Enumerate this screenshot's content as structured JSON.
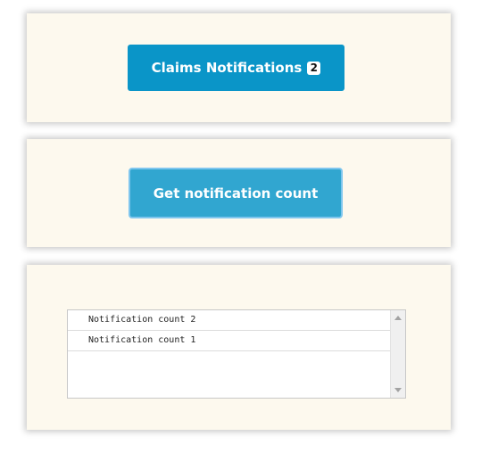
{
  "claims_button": {
    "label": "Claims Notifications",
    "badge_count": "2"
  },
  "get_count_button": {
    "label": "Get notification count"
  },
  "notification_list": {
    "items": [
      "Notification count 2",
      "Notification count 1"
    ]
  },
  "colors": {
    "panel_background": "#fdf9ee",
    "claims_button": "#0a95c8",
    "get_count_button": "#31a6d0",
    "get_count_focus_border": "#7fc6ee"
  },
  "icons": {
    "scroll_up": "scroll-up-arrow-icon",
    "scroll_down": "scroll-down-arrow-icon"
  }
}
